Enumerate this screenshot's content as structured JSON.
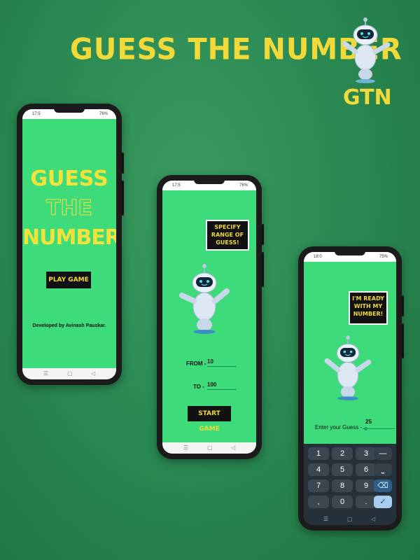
{
  "header": {
    "title": "GUESS THE NUMBER",
    "logo_text": "GTN"
  },
  "phone1": {
    "time": "17:5",
    "battery": "76%",
    "title_lines": [
      "GUESS",
      "THE",
      "NUMBER"
    ],
    "play_label": "PLAY GAME",
    "credit": "Developed by Avinash Pauskar."
  },
  "phone2": {
    "time": "17:5",
    "battery": "76%",
    "bubble": "SPECIFY RANGE OF GUESS!",
    "from_label": "FROM -",
    "from_value": "10",
    "to_label": "TO -",
    "to_value": "100",
    "start_label": "START GAME"
  },
  "phone3": {
    "time": "18:0",
    "battery": "75%",
    "bubble": "I'M READY WITH MY NUMBER!",
    "guess_label": "Enter your Guess -",
    "guess_value": "25",
    "keys": [
      [
        "1",
        "2",
        "3",
        "—"
      ],
      [
        "4",
        "5",
        "6",
        "⎵"
      ],
      [
        "7",
        "8",
        "9",
        "⌫"
      ],
      [
        ",",
        "0",
        ".",
        "✓"
      ]
    ]
  },
  "nav": {
    "menu": "☰",
    "home": "▢",
    "back": "◁"
  },
  "colors": {
    "screen": "#3edb7b",
    "accent": "#f2d93a",
    "bg": "#2a8a52"
  }
}
